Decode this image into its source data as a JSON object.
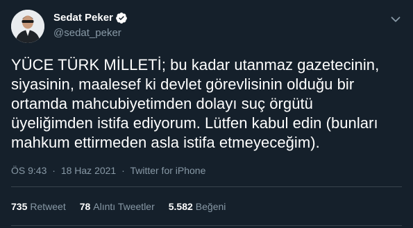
{
  "author": {
    "display_name": "Sedat Peker",
    "handle": "@sedat_peker",
    "verified": true,
    "avatar_icon": "profile-photo"
  },
  "tweet": {
    "lines": [
      "YÜCE TÜRK MİLLETİ; bu kadar utanmaz gazetecinin,",
      "siyasinin, maalesef ki devlet görevlisinin olduğu bir",
      "ortamda mahcubiyetimden dolayı suç örgütü",
      "üyeliğimden istifa ediyorum.  Lütfen kabul edin (bunları",
      "mahkum ettirmeden asla istifa etmeyeceğim)."
    ]
  },
  "meta": {
    "time": "ÖS 9:43",
    "separator": "·",
    "date": "18 Haz 2021",
    "source": "Twitter for iPhone"
  },
  "stats": {
    "retweets": {
      "count": "735",
      "label": "Retweet"
    },
    "quotes": {
      "count": "78",
      "label": "Alıntı Tweetler"
    },
    "likes": {
      "count": "5.582",
      "label": "Beğeni"
    }
  },
  "colors": {
    "background": "#15202b",
    "secondary_text": "#8899a6",
    "verified_badge": "#ffffff",
    "divider": "#38444d"
  }
}
